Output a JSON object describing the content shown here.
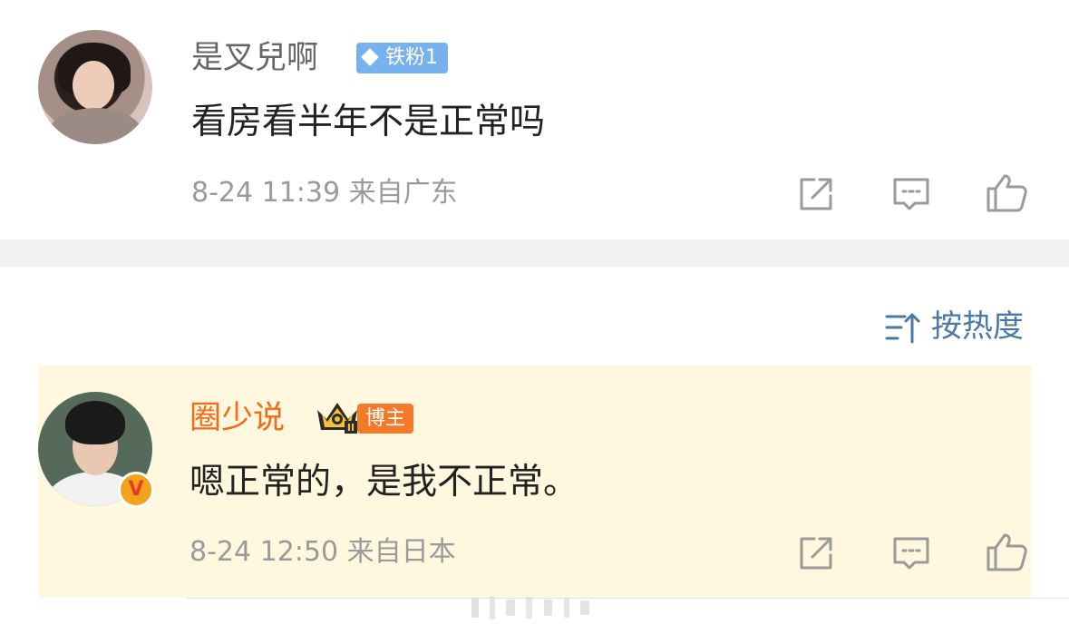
{
  "comment1": {
    "username": "是叉兒啊",
    "fan_badge": "铁粉1",
    "text": "看房看半年不是正常吗",
    "meta": "8-24 11:39  来自广东"
  },
  "sort": {
    "label": "按热度"
  },
  "comment2": {
    "username": "圈少说",
    "role_badge": "博主",
    "verified_mark": "V",
    "text": "嗯正常的，是我不正常。",
    "meta": "8-24 12:50  来自日本"
  },
  "icons": {
    "share": "share-icon",
    "comment": "comment-icon",
    "like": "like-icon",
    "sort": "sort-icon",
    "crown": "crown-icon"
  },
  "colors": {
    "blogger_name": "#f36a18",
    "link_blue": "#4a79a6",
    "fan_badge": "#78b1f0",
    "highlight_bg": "#fff7de"
  }
}
